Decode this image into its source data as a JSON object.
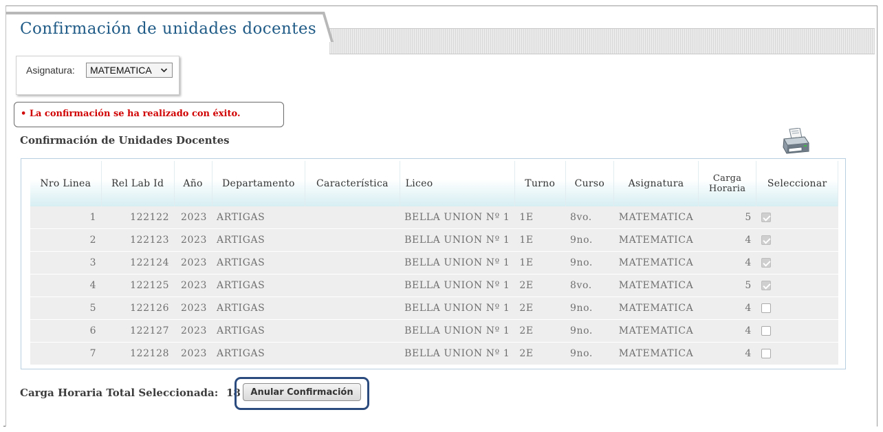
{
  "page": {
    "title": "Confirmación de unidades docentes"
  },
  "filter": {
    "label": "Asignatura:",
    "selected": "MATEMATICA"
  },
  "message": "• La confirmación se ha realizado con éxito.",
  "section_title": "Confirmación de Unidades Docentes",
  "table": {
    "columns": [
      "Nro Linea",
      "Rel Lab Id",
      "Año",
      "Departamento",
      "Característica",
      "Liceo",
      "Turno",
      "Curso",
      "Asignatura",
      "Carga Horaria",
      "Seleccionar"
    ],
    "rows": [
      {
        "nro": "1",
        "rel": "122122",
        "anio": "2023",
        "depto": "ARTIGAS",
        "caract": "",
        "liceo": "BELLA UNION Nº 1",
        "turno": "1E",
        "curso": "8vo.",
        "asig": "MATEMATICA",
        "carga": "5",
        "selected": true,
        "disabled": true
      },
      {
        "nro": "2",
        "rel": "122123",
        "anio": "2023",
        "depto": "ARTIGAS",
        "caract": "",
        "liceo": "BELLA UNION Nº 1",
        "turno": "1E",
        "curso": "9no.",
        "asig": "MATEMATICA",
        "carga": "4",
        "selected": true,
        "disabled": true
      },
      {
        "nro": "3",
        "rel": "122124",
        "anio": "2023",
        "depto": "ARTIGAS",
        "caract": "",
        "liceo": "BELLA UNION Nº 1",
        "turno": "1E",
        "curso": "9no.",
        "asig": "MATEMATICA",
        "carga": "4",
        "selected": true,
        "disabled": true
      },
      {
        "nro": "4",
        "rel": "122125",
        "anio": "2023",
        "depto": "ARTIGAS",
        "caract": "",
        "liceo": "BELLA UNION Nº 1",
        "turno": "2E",
        "curso": "8vo.",
        "asig": "MATEMATICA",
        "carga": "5",
        "selected": true,
        "disabled": true
      },
      {
        "nro": "5",
        "rel": "122126",
        "anio": "2023",
        "depto": "ARTIGAS",
        "caract": "",
        "liceo": "BELLA UNION Nº 1",
        "turno": "2E",
        "curso": "9no.",
        "asig": "MATEMATICA",
        "carga": "4",
        "selected": false,
        "disabled": false
      },
      {
        "nro": "6",
        "rel": "122127",
        "anio": "2023",
        "depto": "ARTIGAS",
        "caract": "",
        "liceo": "BELLA UNION Nº 1",
        "turno": "2E",
        "curso": "9no.",
        "asig": "MATEMATICA",
        "carga": "4",
        "selected": false,
        "disabled": false
      },
      {
        "nro": "7",
        "rel": "122128",
        "anio": "2023",
        "depto": "ARTIGAS",
        "caract": "",
        "liceo": "BELLA UNION Nº 1",
        "turno": "2E",
        "curso": "9no.",
        "asig": "MATEMATICA",
        "carga": "4",
        "selected": false,
        "disabled": false
      }
    ]
  },
  "footer": {
    "total_label": "Carga Horaria Total Seleccionada:",
    "total_value": "18",
    "anular_label": "Anular Confirmación"
  },
  "icons": {
    "print": "printer-icon",
    "dropdown": "chevron-down-icon"
  },
  "colors": {
    "title": "#1f5b86",
    "message": "#d10000",
    "highlight": "#2b4b7f",
    "header_gradient_end": "#d6eef2"
  }
}
